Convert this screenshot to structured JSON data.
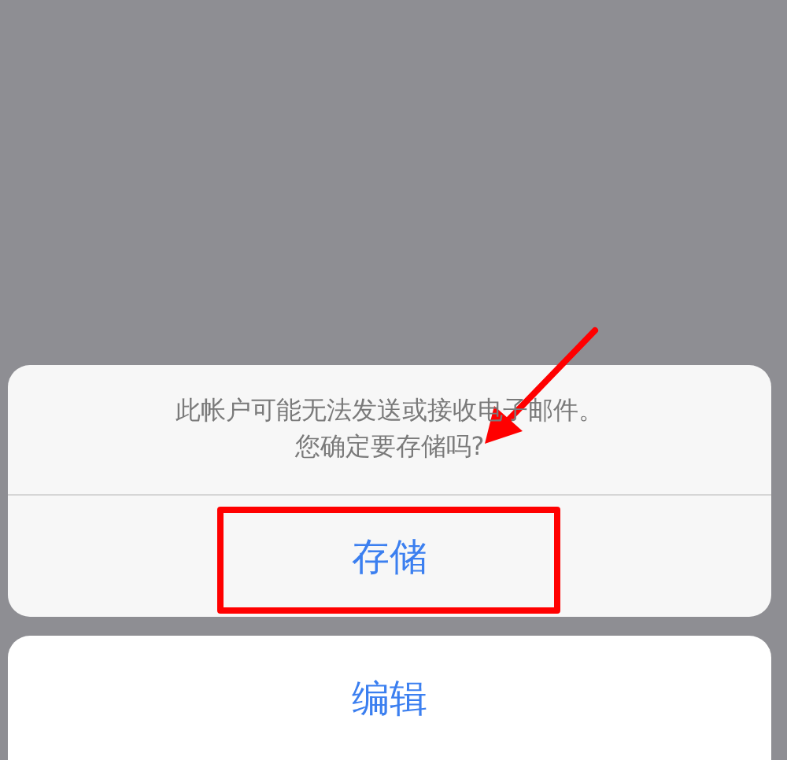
{
  "alert": {
    "message_lines": [
      "此帐户可能无法发送或接收电子邮件。",
      "您确定要存储吗?"
    ],
    "actions": [
      {
        "label": "存储",
        "framed": true
      }
    ]
  },
  "second_sheet": {
    "actions": [
      {
        "label": "编辑",
        "framed": false
      }
    ]
  },
  "annotations": [
    {
      "kind": "arrow"
    }
  ]
}
